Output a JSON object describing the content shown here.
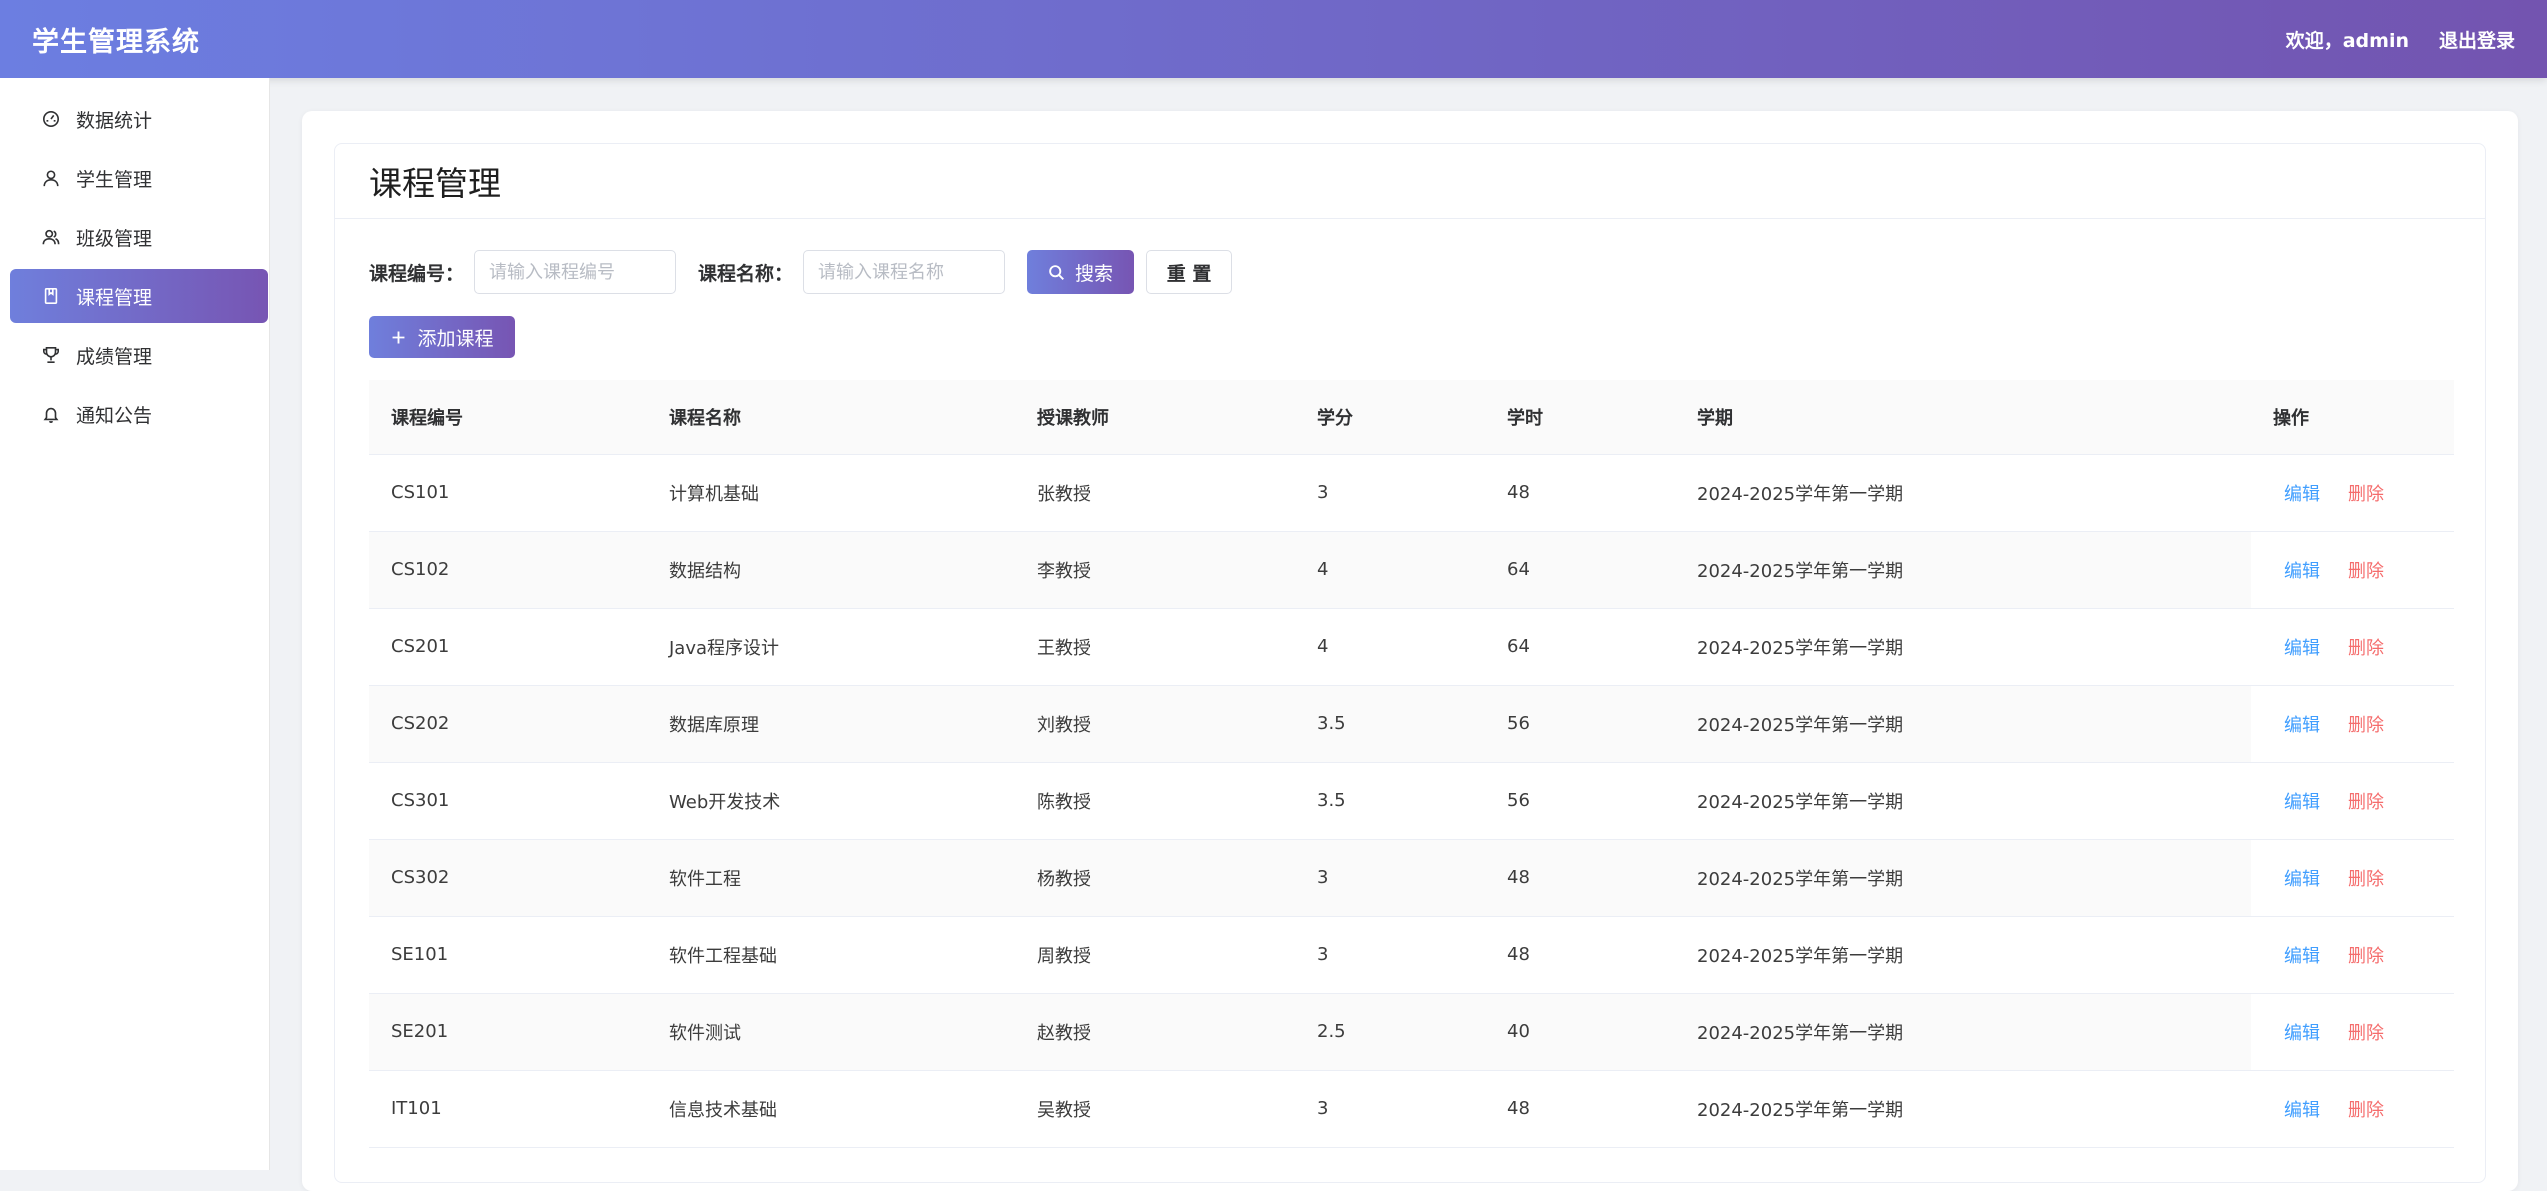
{
  "header": {
    "title": "学生管理系统",
    "welcome": "欢迎，admin",
    "logout": "退出登录"
  },
  "sidebar": {
    "items": [
      {
        "label": "数据统计",
        "icon": "dashboard-icon"
      },
      {
        "label": "学生管理",
        "icon": "user-icon"
      },
      {
        "label": "班级管理",
        "icon": "users-icon"
      },
      {
        "label": "课程管理",
        "icon": "book-icon",
        "active": true
      },
      {
        "label": "成绩管理",
        "icon": "trophy-icon"
      },
      {
        "label": "通知公告",
        "icon": "bell-icon"
      }
    ]
  },
  "page": {
    "title": "课程管理"
  },
  "search": {
    "code_label": "课程编号：",
    "code_placeholder": "请输入课程编号",
    "name_label": "课程名称：",
    "name_placeholder": "请输入课程名称",
    "search_button": "搜索",
    "reset_button": "重 置"
  },
  "add_button": "添加课程",
  "table": {
    "columns": [
      "课程编号",
      "课程名称",
      "授课教师",
      "学分",
      "学时",
      "学期",
      "操作"
    ],
    "edit_label": "编辑",
    "delete_label": "删除",
    "rows": [
      [
        "CS101",
        "计算机基础",
        "张教授",
        "3",
        "48",
        "2024-2025学年第一学期"
      ],
      [
        "CS102",
        "数据结构",
        "李教授",
        "4",
        "64",
        "2024-2025学年第一学期"
      ],
      [
        "CS201",
        "Java程序设计",
        "王教授",
        "4",
        "64",
        "2024-2025学年第一学期"
      ],
      [
        "CS202",
        "数据库原理",
        "刘教授",
        "3.5",
        "56",
        "2024-2025学年第一学期"
      ],
      [
        "CS301",
        "Web开发技术",
        "陈教授",
        "3.5",
        "56",
        "2024-2025学年第一学期"
      ],
      [
        "CS302",
        "软件工程",
        "杨教授",
        "3",
        "48",
        "2024-2025学年第一学期"
      ],
      [
        "SE101",
        "软件工程基础",
        "周教授",
        "3",
        "48",
        "2024-2025学年第一学期"
      ],
      [
        "SE201",
        "软件测试",
        "赵教授",
        "2.5",
        "40",
        "2024-2025学年第一学期"
      ],
      [
        "IT101",
        "信息技术基础",
        "吴教授",
        "3",
        "48",
        "2024-2025学年第一学期"
      ]
    ]
  }
}
